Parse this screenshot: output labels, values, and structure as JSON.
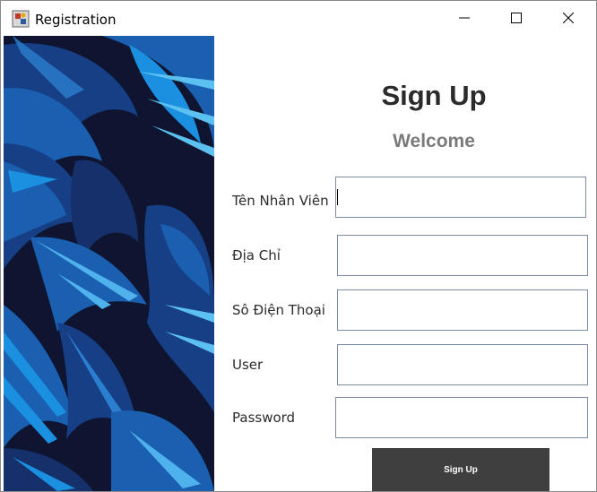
{
  "window": {
    "title": "Registration"
  },
  "form": {
    "title": "Sign Up",
    "subtitle": "Welcome",
    "fields": [
      {
        "label": "Tên Nhân Viên",
        "value": ""
      },
      {
        "label": "Địa Chỉ",
        "value": ""
      },
      {
        "label": "Sô Điện Thoại",
        "value": ""
      },
      {
        "label": "User",
        "value": ""
      },
      {
        "label": "Password",
        "value": ""
      }
    ],
    "submit_label": "Sign Up"
  },
  "colors": {
    "panel_bg": "#0f1530",
    "leaf_bright": "#1b8fe0",
    "leaf_mid": "#1a5fb0",
    "leaf_dark": "#173f86",
    "button_bg": "#3f3f3f"
  },
  "icons": {
    "app": "java-app-icon",
    "minimize": "minimize-icon",
    "maximize": "maximize-icon",
    "close": "close-icon"
  }
}
